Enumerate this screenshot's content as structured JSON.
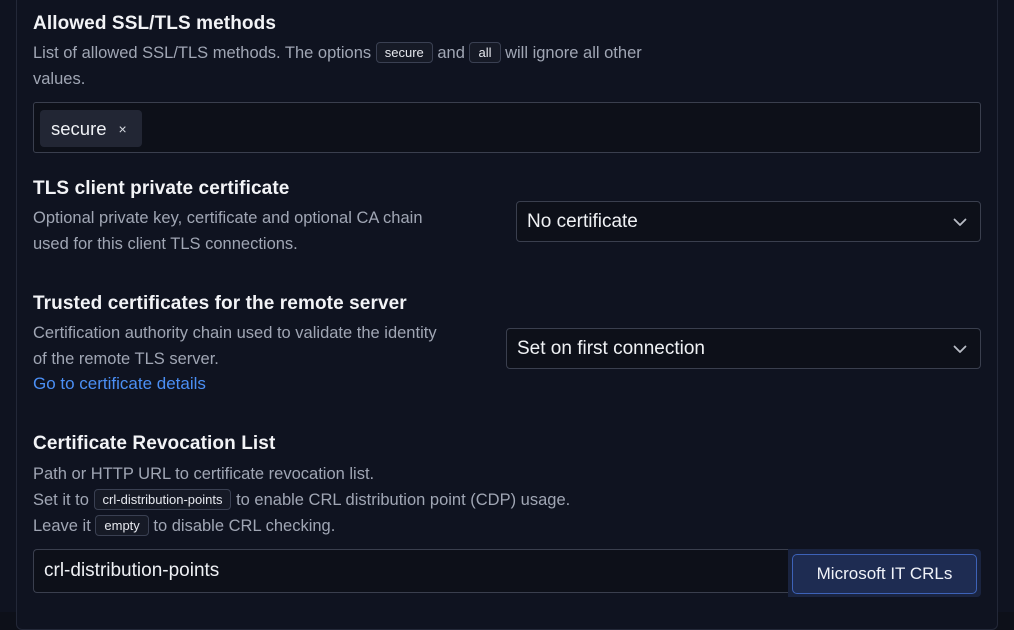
{
  "ssl_methods": {
    "title": "Allowed SSL/TLS methods",
    "desc_part1": "List of allowed SSL/TLS methods. The options",
    "code_secure": "secure",
    "desc_and": "and",
    "code_all": "all",
    "desc_part2": "will ignore all other",
    "desc_line2": "values.",
    "tags": [
      "secure"
    ],
    "remove_glyph": "×"
  },
  "client_cert": {
    "title": "TLS client private certificate",
    "desc_line1": "Optional private key, certificate and optional CA chain",
    "desc_line2": "used for this client TLS connections.",
    "selected": "No certificate"
  },
  "trusted_certs": {
    "title": "Trusted certificates for the remote server",
    "desc_line1": "Certification authority chain used to validate the identity",
    "desc_line2": "of the remote TLS server.",
    "link": "Go to certificate details",
    "selected": "Set on first connection"
  },
  "crl": {
    "title": "Certificate Revocation List",
    "desc_line1": "Path or HTTP URL to certificate revocation list.",
    "desc_line2_a": "Set it to",
    "code_cdp": "crl-distribution-points",
    "desc_line2_b": "to enable CRL distribution point (CDP) usage.",
    "desc_line3_a": "Leave it",
    "code_empty": "empty",
    "desc_line3_b": "to disable CRL checking.",
    "input_value": "crl-distribution-points",
    "button_label": "Microsoft IT CRLs"
  },
  "colors": {
    "background": "#0f1320",
    "link": "#4b8ff5",
    "button_border": "#3d62b8"
  }
}
